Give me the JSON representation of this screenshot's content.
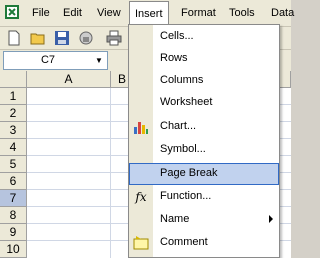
{
  "menubar": {
    "items": [
      {
        "label": "File",
        "mnemonic": "F"
      },
      {
        "label": "Edit",
        "mnemonic": "E"
      },
      {
        "label": "View",
        "mnemonic": "V"
      },
      {
        "label": "Insert",
        "mnemonic": "I"
      },
      {
        "label": "Format",
        "mnemonic": "o"
      },
      {
        "label": "Tools",
        "mnemonic": "T"
      },
      {
        "label": "Data",
        "mnemonic": "D"
      }
    ]
  },
  "namebox": {
    "value": "C7"
  },
  "grid": {
    "columns": [
      "A",
      "B"
    ],
    "rows": [
      "1",
      "2",
      "3",
      "4",
      "5",
      "6",
      "7",
      "8",
      "9",
      "10"
    ],
    "selected_row": "7"
  },
  "insert_menu": {
    "items": [
      {
        "label": "Cells...",
        "u": "E"
      },
      {
        "label": "Rows",
        "u": "R"
      },
      {
        "label": "Columns",
        "u": "C"
      },
      {
        "label": "Worksheet",
        "u": "W"
      },
      {
        "label": "Chart...",
        "u": "H",
        "icon": "chart-icon"
      },
      {
        "label": "Symbol...",
        "u": "S"
      },
      {
        "label": "Page Break",
        "u": "B",
        "highlighted": true
      },
      {
        "label": "Function...",
        "u": "F",
        "icon": "function-icon"
      },
      {
        "label": "Name",
        "u": "N",
        "submenu": true
      },
      {
        "label": "Comment",
        "u": "M",
        "icon": "comment-icon"
      }
    ]
  },
  "colors": {
    "highlight": "#c1d2ee",
    "highlight_border": "#316ac5",
    "selected_row": "#b6c4de"
  }
}
